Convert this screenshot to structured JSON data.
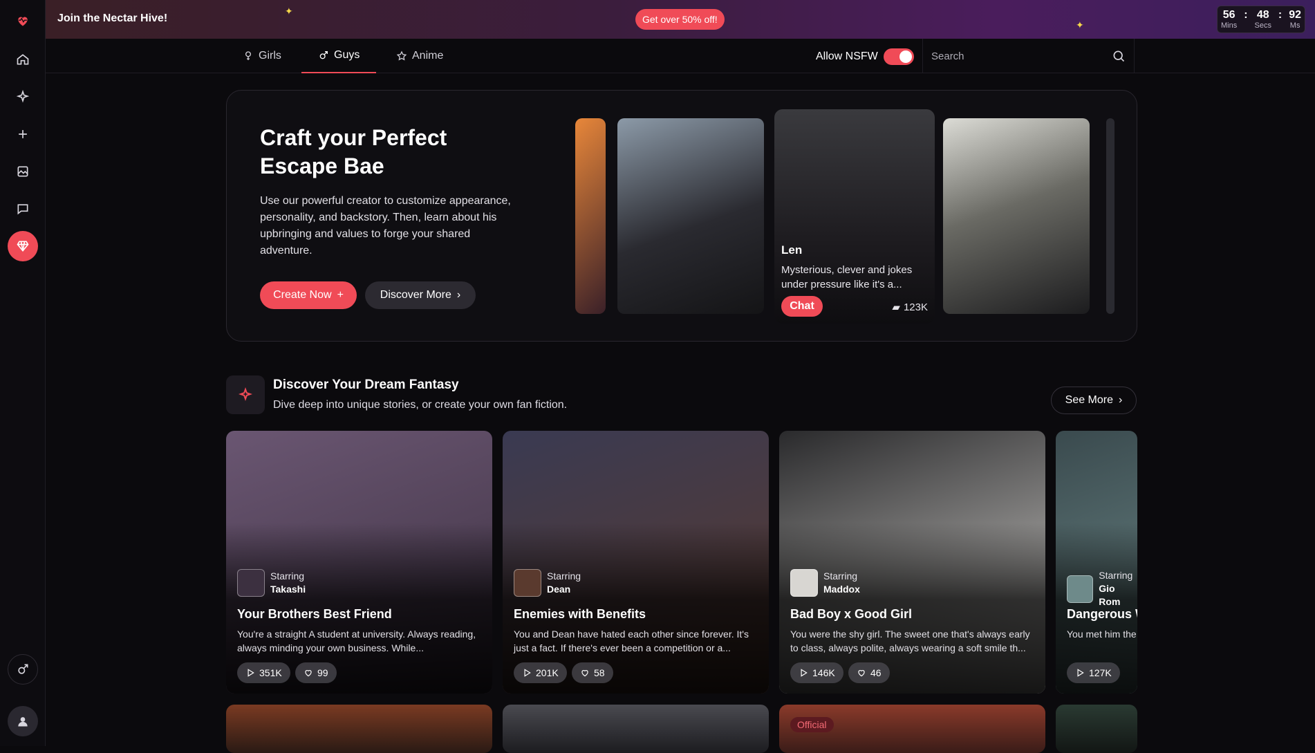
{
  "topbar": {
    "title": "Join the Nectar Hive!",
    "promo": "Get over 50% off!",
    "timer": [
      {
        "value": "56",
        "label": "Mins"
      },
      {
        "value": "48",
        "label": "Secs"
      },
      {
        "value": "92",
        "label": "Ms"
      }
    ],
    "timer_sep": ":"
  },
  "nav": {
    "tabs": [
      {
        "label": "Girls",
        "icon": "female-icon"
      },
      {
        "label": "Guys",
        "icon": "male-icon"
      },
      {
        "label": "Anime",
        "icon": "star-icon"
      }
    ],
    "active_tab": "Guys",
    "nsfw_label": "Allow NSFW",
    "nsfw_on": true,
    "search_placeholder": "Search"
  },
  "hero": {
    "title": "Craft your Perfect Escape Bae",
    "description": "Use our powerful creator to customize appearance, personality, and backstory. Then, learn about his upbringing and values to forge your shared adventure.",
    "create_label": "Create Now",
    "discover_label": "Discover More",
    "featured": {
      "name": "Len",
      "description": "Mysterious, clever and jokes under pressure like it's a...",
      "chat_label": "Chat",
      "count": "123K"
    }
  },
  "section": {
    "title": "Discover Your Dream Fantasy",
    "subtitle": "Dive deep into unique stories, or create your own fan fiction.",
    "see_more": "See More"
  },
  "stories": [
    {
      "starring_label": "Starring",
      "star": "Takashi",
      "title": "Your Brothers Best Friend",
      "desc": "You're a straight A student at university. Always reading, always minding your own business. While...",
      "plays": "351K",
      "likes": "99",
      "color_a": "#3c3040",
      "color_b": "#6a5672"
    },
    {
      "starring_label": "Starring",
      "star": "Dean",
      "title": "Enemies with Benefits",
      "desc": "You and Dean have hated each other since forever. It's just a fact. If there's ever been a competition or a...",
      "plays": "201K",
      "likes": "58",
      "color_a": "#5a3a2e",
      "color_b": "#3a3a52"
    },
    {
      "starring_label": "Starring",
      "star": "Maddox",
      "title": "Bad Boy x Good Girl",
      "desc": "You were the shy girl. The sweet one that's always early to class, always polite, always wearing a soft smile th...",
      "plays": "146K",
      "likes": "46",
      "color_a": "#d8d6d2",
      "color_b": "#2a2a2c"
    },
    {
      "starring_label": "Starring",
      "star": "Gio Rom",
      "title": "Dangerous W",
      "desc": "You met him the threatened the c",
      "plays": "127K",
      "likes": "",
      "color_a": "#6e8a8a",
      "color_b": "#3a4a4e"
    }
  ],
  "bottom": {
    "official_label": "Official"
  }
}
